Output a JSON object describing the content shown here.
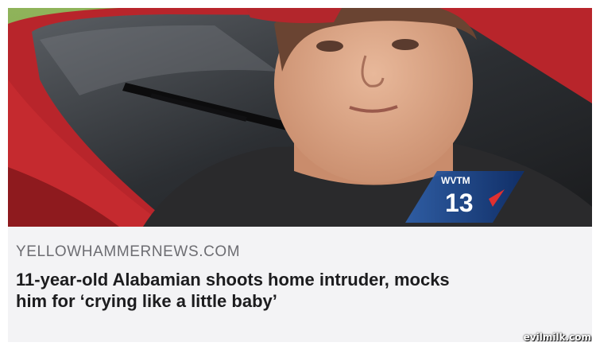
{
  "article": {
    "source": "YELLOWHAMMERNEWS.COM",
    "headline_line1": "11-year-old Alabamian shoots home intruder, mocks",
    "headline_line2": "him for ‘crying like a little baby’"
  },
  "tv_badge": {
    "station": "WVTM",
    "channel": "13"
  },
  "watermark": "evilmilk.com"
}
